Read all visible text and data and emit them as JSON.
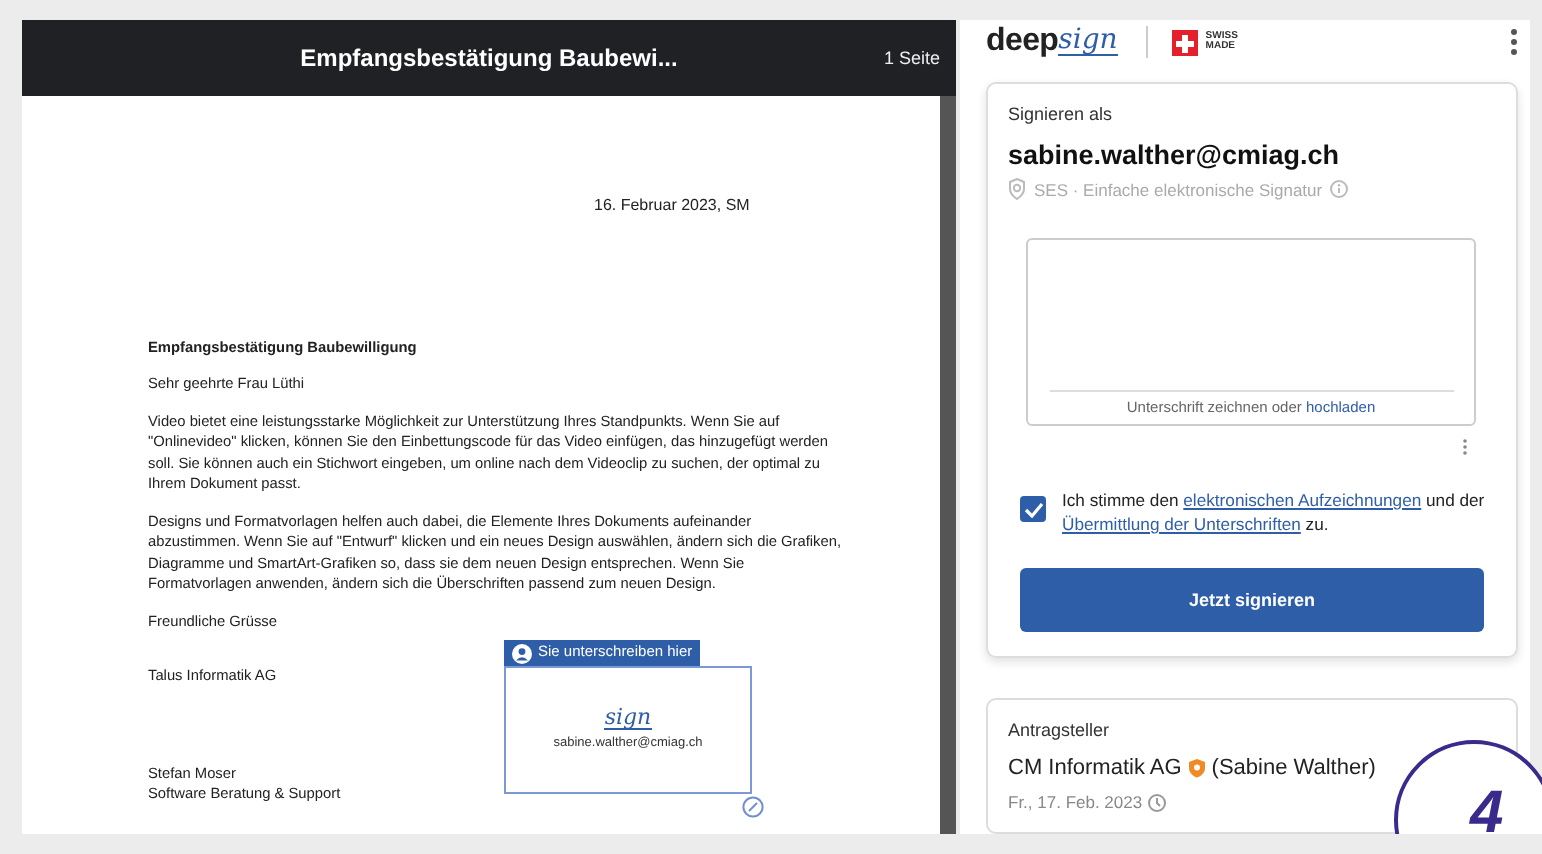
{
  "document": {
    "title": "Empfangsbestätigung Baubewi...",
    "page_count": "1 Seite",
    "date": "16. Februar 2023, SM",
    "subject": "Empfangsbestätigung Baubewilligung",
    "salutation": "Sehr geehrte Frau Lüthi",
    "paragraphs": [
      "Video bietet eine leistungsstarke Möglichkeit zur Unterstützung Ihres Standpunkts. Wenn Sie auf \"Onlinevideo\" klicken, können Sie den Einbettungscode für das Video einfügen, das hinzugefügt werden soll. Sie können auch ein Stichwort eingeben, um online nach dem Videoclip zu suchen, der optimal zu Ihrem Dokument passt.",
      "Designs und Formatvorlagen helfen auch dabei, die Elemente Ihres Dokuments aufeinander abzustimmen. Wenn Sie auf \"Entwurf\" klicken und ein neues Design auswählen, ändern sich die Grafiken, Diagramme und SmartArt-Grafiken so, dass sie dem neuen Design entsprechen. Wenn Sie Formatvorlagen anwenden, ändern sich die Überschriften passend zum neuen Design."
    ],
    "closing": "Freundliche Grüsse",
    "company": "Talus Informatik AG",
    "signer_name": "Stefan Moser",
    "signer_role": "Software Beratung & Support",
    "signature_field": {
      "label": "Sie unterschreiben hier",
      "signature": "sign",
      "email": "sabine.walther@cmiag.ch"
    }
  },
  "panel": {
    "logo": {
      "word": "deep",
      "script": "sign",
      "badge": [
        "SWISS",
        "MADE"
      ]
    },
    "signing": {
      "label": "Signieren als",
      "email": "sabine.walther@cmiag.ch",
      "signature_type": "SES · Einfache elektronische Signatur",
      "pad_hint": [
        {
          "kind": "text",
          "text": "Unterschrift zeichnen oder "
        },
        {
          "kind": "link",
          "text": "hochladen"
        }
      ],
      "consent": {
        "checked": true,
        "parts": [
          {
            "kind": "text",
            "text": "Ich stimme den "
          },
          {
            "kind": "link",
            "text": "elektronischen Aufzeichnungen"
          },
          {
            "kind": "text",
            "text": " und der "
          },
          {
            "kind": "link",
            "text": "Übermittlung der Unterschriften"
          },
          {
            "kind": "text",
            "text": " zu."
          }
        ]
      },
      "button": "Jetzt signieren"
    },
    "applicant": {
      "label": "Antragsteller",
      "company": "CM Informatik AG",
      "person": "(Sabine Walther)",
      "date": "Fr., 17. Feb. 2023"
    }
  },
  "callout": "4"
}
